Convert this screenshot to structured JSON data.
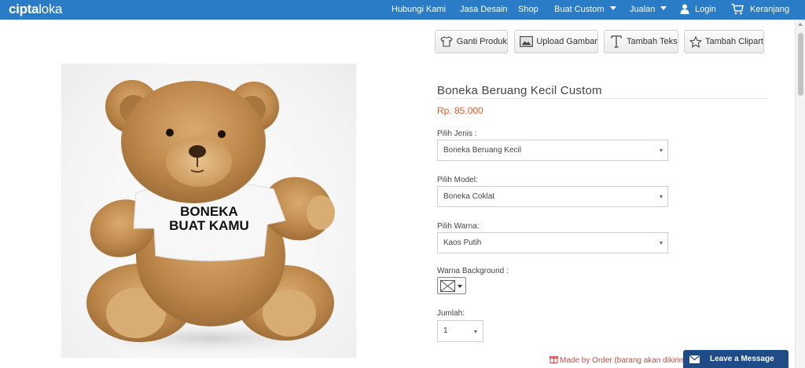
{
  "nav": {
    "logo_a": "cipta",
    "logo_b": "loka",
    "items": [
      {
        "label": "Hubungi Kami"
      },
      {
        "label": "Jasa Desain"
      },
      {
        "label": "Shop"
      },
      {
        "label": "Buat Custom"
      },
      {
        "label": "Jualan"
      },
      {
        "label": "Login"
      },
      {
        "label": "Keranjang"
      }
    ]
  },
  "tools": [
    {
      "label": "Ganti Produk",
      "icon": "tshirt-icon"
    },
    {
      "label": "Upload Gambar",
      "icon": "image-icon"
    },
    {
      "label": "Tambah Teks",
      "icon": "text-icon"
    },
    {
      "label": "Tambah Clipart",
      "icon": "star-icon"
    }
  ],
  "product": {
    "image_text_line1": "BONEKA",
    "image_text_line2": "BUAT KAMU",
    "title": "Boneka Beruang Kecil Custom",
    "price": "Rp. 85.000"
  },
  "form": {
    "jenis_label": "Pilih Jenis :",
    "jenis_value": "Boneka Beruang Kecil",
    "model_label": "Pilih Model:",
    "model_value": "Boneka Coklat",
    "warna_label": "Pilih Warna:",
    "warna_value": "Kaos Putih",
    "bg_label": "Warna Background :",
    "qty_label": "Jumlah:",
    "qty_value": "1"
  },
  "footer": {
    "made_by_order": "Made by Order (barang akan dikirim",
    "leave_message": "Leave a Message"
  },
  "colors": {
    "nav_bg": "#2a7cc7",
    "price": "#e05a27",
    "chat_bg": "#1f4c87"
  }
}
